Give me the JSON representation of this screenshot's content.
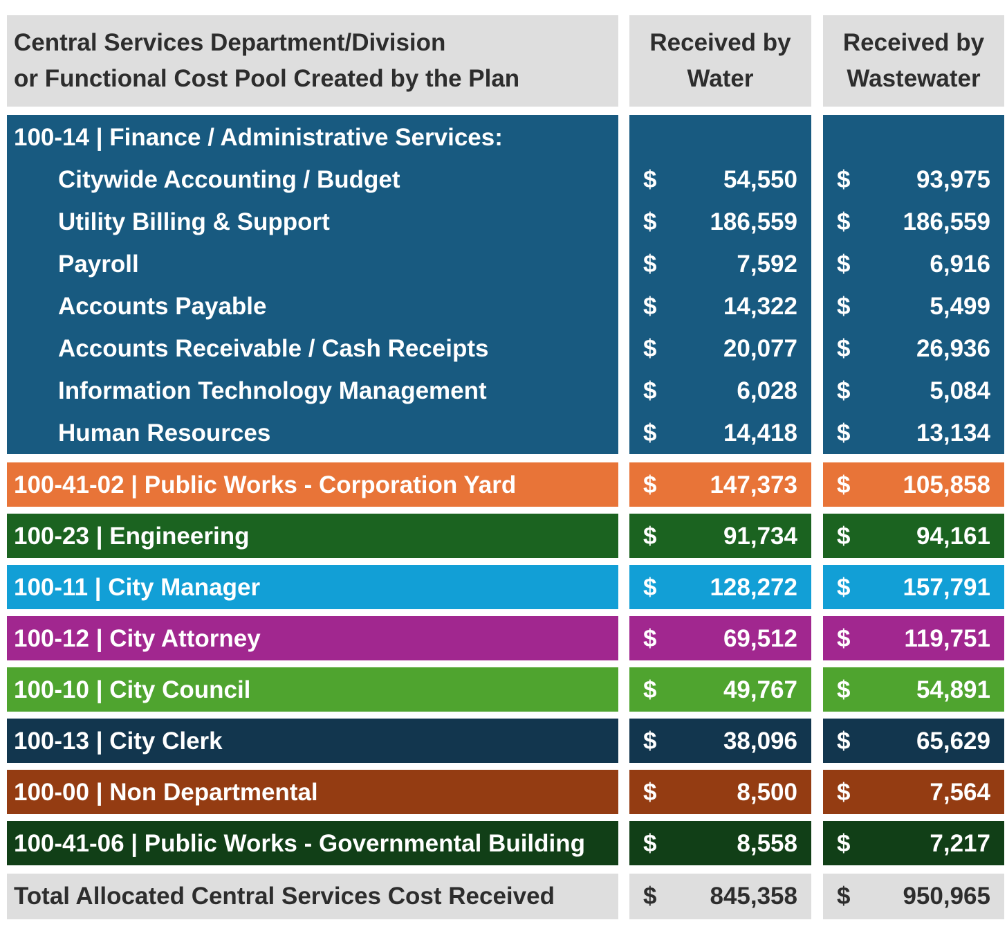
{
  "header": {
    "col1_line1": "Central Services Department/Division",
    "col1_line2": "or Functional Cost Pool Created by the Plan",
    "col2_line1": "Received by",
    "col2_line2": "Water",
    "col3_line1": "Received by",
    "col3_line2": "Wastewater"
  },
  "finance": {
    "title": "100-14 | Finance / Administrative Services:",
    "color": "#185a80",
    "items": [
      {
        "label": "Citywide Accounting / Budget",
        "water": "54,550",
        "wastewater": "93,975"
      },
      {
        "label": "Utility Billing & Support",
        "water": "186,559",
        "wastewater": "186,559"
      },
      {
        "label": "Payroll",
        "water": "7,592",
        "wastewater": "6,916"
      },
      {
        "label": "Accounts Payable",
        "water": "14,322",
        "wastewater": "5,499"
      },
      {
        "label": "Accounts Receivable / Cash Receipts",
        "water": "20,077",
        "wastewater": "26,936"
      },
      {
        "label": "Information Technology Management",
        "water": "6,028",
        "wastewater": "5,084"
      },
      {
        "label": "Human Resources",
        "water": "14,418",
        "wastewater": "13,134"
      }
    ]
  },
  "rows": [
    {
      "label": "100-41-02 | Public Works - Corporation Yard",
      "water": "147,373",
      "wastewater": "105,858",
      "color": "#e87438"
    },
    {
      "label": "100-23 | Engineering",
      "water": "91,734",
      "wastewater": "94,161",
      "color": "#1b6320"
    },
    {
      "label": "100-11 | City Manager",
      "water": "128,272",
      "wastewater": "157,791",
      "color": "#129fd6"
    },
    {
      "label": "100-12 | City Attorney",
      "water": "69,512",
      "wastewater": "119,751",
      "color": "#a1278f"
    },
    {
      "label": "100-10 | City Council",
      "water": "49,767",
      "wastewater": "54,891",
      "color": "#4fa42f"
    },
    {
      "label": "100-13 | City Clerk",
      "water": "38,096",
      "wastewater": "65,629",
      "color": "#12364e"
    },
    {
      "label": "100-00 | Non Departmental",
      "water": "8,500",
      "wastewater": "7,564",
      "color": "#943c12"
    },
    {
      "label": "100-41-06 | Public Works - Governmental Building",
      "water": "8,558",
      "wastewater": "7,217",
      "color": "#113f17"
    }
  ],
  "total": {
    "label": "Total Allocated Central Services Cost Received",
    "water": "845,358",
    "wastewater": "950,965"
  },
  "currency_symbol": "$"
}
